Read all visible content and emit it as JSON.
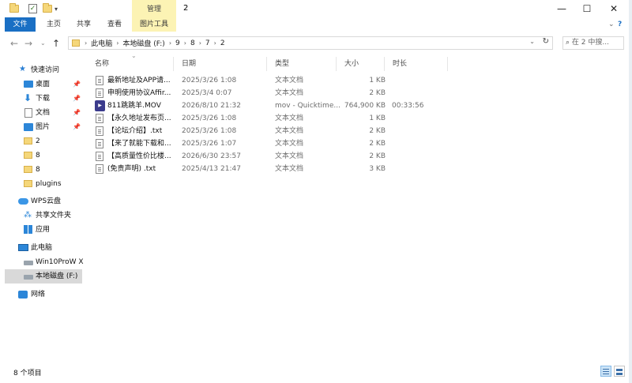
{
  "window": {
    "title": "2",
    "manage_tab": "管理",
    "controls": {
      "minimize": "—",
      "maximize": "☐",
      "close": "✕"
    }
  },
  "ribbon": {
    "tabs": [
      "文件",
      "主页",
      "共享",
      "查看",
      "图片工具"
    ]
  },
  "address": {
    "path": [
      "此电脑",
      "本地磁盘 (F:)",
      "9",
      "8",
      "7",
      "2"
    ],
    "search_placeholder": "在 2 中搜..."
  },
  "nav": {
    "quick_access": "快速访问",
    "pinned": [
      {
        "label": "桌面",
        "icon": "desktop-icon"
      },
      {
        "label": "下载",
        "icon": "download-icon"
      },
      {
        "label": "文档",
        "icon": "documents-icon"
      },
      {
        "label": "图片",
        "icon": "pictures-icon"
      }
    ],
    "folders": [
      "2",
      "8",
      "8",
      "plugins"
    ],
    "wps_cloud": "WPS云盘",
    "shared_folder": "共享文件夹",
    "apps": "应用",
    "this_pc": "此电脑",
    "drives": [
      "Win10ProW X",
      "本地磁盘 (F:)"
    ],
    "network": "网络"
  },
  "columns": [
    "名称",
    "日期",
    "类型",
    "大小",
    "时长"
  ],
  "files": [
    {
      "name": "最新地址及APP请...",
      "date": "2025/3/26 1:08",
      "type": "文本文档",
      "size": "1 KB",
      "duration": "",
      "kind": "txt"
    },
    {
      "name": "申明使用协议Affir...",
      "date": "2025/3/4 0:07",
      "type": "文本文档",
      "size": "2 KB",
      "duration": "",
      "kind": "txt"
    },
    {
      "name": "811跳跳羊.MOV",
      "date": "2026/8/10 21:32",
      "type": "mov - Quicktime...",
      "size": "764,900 KB",
      "duration": "00:33:56",
      "kind": "mov"
    },
    {
      "name": "【永久地址发布页...",
      "date": "2025/3/26 1:08",
      "type": "文本文档",
      "size": "1 KB",
      "duration": "",
      "kind": "txt"
    },
    {
      "name": "【论坛介绍】.txt",
      "date": "2025/3/26 1:08",
      "type": "文本文档",
      "size": "2 KB",
      "duration": "",
      "kind": "txt"
    },
    {
      "name": "【来了就能下载和...",
      "date": "2025/3/26 1:07",
      "type": "文本文档",
      "size": "2 KB",
      "duration": "",
      "kind": "txt"
    },
    {
      "name": "【高质量性价比楼...",
      "date": "2026/6/30 23:57",
      "type": "文本文档",
      "size": "2 KB",
      "duration": "",
      "kind": "txt"
    },
    {
      "name": "(免责声明) .txt",
      "date": "2025/4/13 21:47",
      "type": "文本文档",
      "size": "3 KB",
      "duration": "",
      "kind": "txt"
    }
  ],
  "status": {
    "item_count": "8 个项目"
  },
  "colors": {
    "accent": "#1a6fc4",
    "manage": "#fcf3b4",
    "selected": "#d9d9d9"
  }
}
